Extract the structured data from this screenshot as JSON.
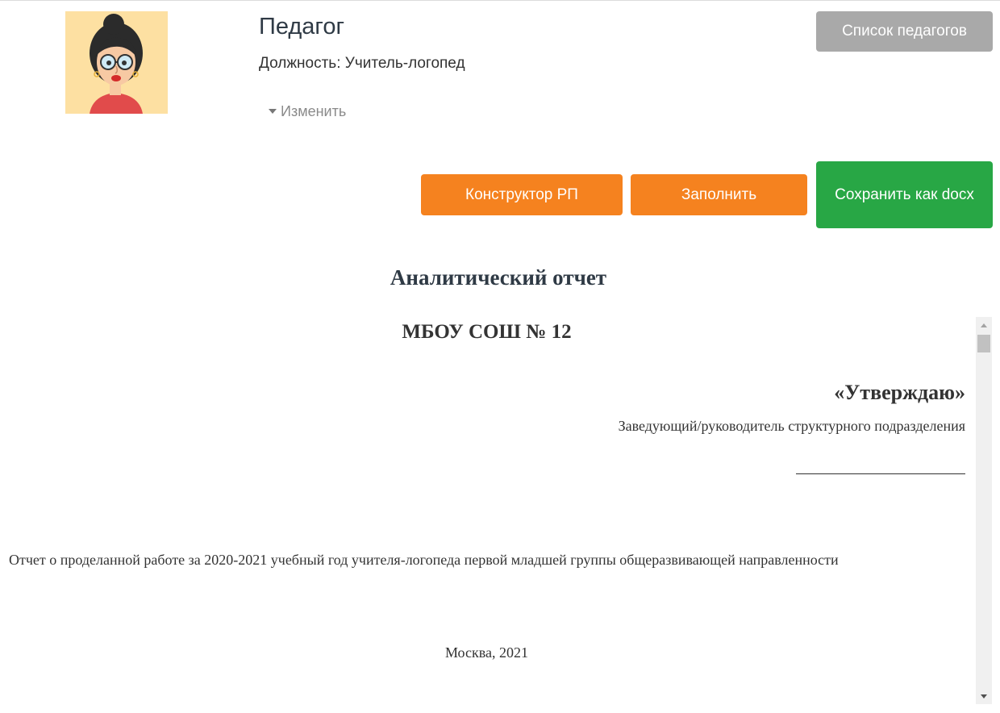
{
  "header": {
    "teacher_title": "Педагог",
    "position": "Должность: Учитель-логопед",
    "change_label": "Изменить",
    "teachers_list_button": "Список педагогов"
  },
  "toolbar": {
    "constructor_button": "Конструктор РП",
    "fill_button": "Заполнить",
    "save_button": "Сохранить как docx"
  },
  "document": {
    "title": "Аналитический отчет",
    "organization": "МБОУ СОШ № 12",
    "approve": "«Утверждаю»",
    "approver": "Заведующий/руководитель структурного подразделения",
    "report_line": "Отчет о проделанной работе за 2020-2021 учебный год учителя-логопеда первой младшей группы общеразвивающей направленности",
    "city_year": "Москва, 2021"
  },
  "colors": {
    "orange": "#f5821f",
    "green": "#28a745",
    "gray": "#a9a9a9",
    "avatar_bg": "#fde0a2"
  },
  "icons": [
    "avatar-illustration",
    "caret-down-icon",
    "scroll-up-icon",
    "scroll-down-icon"
  ]
}
